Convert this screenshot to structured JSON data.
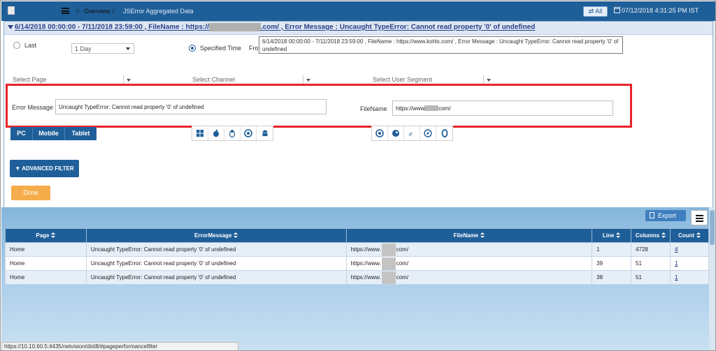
{
  "header": {
    "breadcrumb_overview": "Overview",
    "breadcrumb_sep": "/",
    "breadcrumb_current": "JSError Aggregated Data",
    "all_button": "All",
    "datetime": "07/12/2018 4:31:25 PM IST"
  },
  "filter": {
    "title_prefix": "6/14/2018 00:00:00 - 7/11/2018 23:59:00 , FileName : https://",
    "title_suffix": ".com/ , Error Message : Uncaught TypeError: Cannot read property '0' of undefined",
    "tooltip": "6/14/2018 00:00:00 - 7/11/2018 23:59:00 ,  FileName : https://www.kohls.com/ ,  Error Message : Uncaught TypeError: Cannot read property '0' of undefined",
    "last_label": "Last",
    "last_value": "1 Day",
    "specified_label": "Specified Time",
    "from_label": "Fron",
    "select_page": "Select Page",
    "select_channel": "Select Channel",
    "select_user_segment": "Select User Segment",
    "error_message_label": "Error Message",
    "error_message_value": "Uncaught TypeError: Cannot read property '0' of undefined",
    "filename_label": "FileName",
    "filename_prefix": "https://www",
    "filename_suffix": "com/",
    "devices": [
      "PC",
      "Mobile",
      "Tablet"
    ],
    "os_icons": [
      "windows-icon",
      "apple-icon",
      "linux-icon",
      "chrome-os-icon",
      "android-icon"
    ],
    "browser_icons": [
      "chrome-icon",
      "firefox-icon",
      "ie-icon",
      "safari-icon",
      "opera-icon"
    ],
    "advanced_filter": "ADVANCED FILTER",
    "done": "Done"
  },
  "table": {
    "export": "Export",
    "columns": [
      "Page",
      "ErrorMessage",
      "FileName",
      "Line",
      "Columns",
      "Count"
    ],
    "rows": [
      {
        "page": "Home",
        "error": "Uncaught TypeError: Cannot read property '0' of undefined",
        "file_prefix": "https://www.",
        "file_suffix": "com/",
        "line": "1",
        "columns": "4728",
        "count": "4"
      },
      {
        "page": "Home",
        "error": "Uncaught TypeError: Cannot read property '0' of undefined",
        "file_prefix": "https://www.",
        "file_suffix": "com/",
        "line": "39",
        "columns": "51",
        "count": "1"
      },
      {
        "page": "Home",
        "error": "Uncaught TypeError: Cannot read property '0' of undefined",
        "file_prefix": "https://www.",
        "file_suffix": "com/",
        "line": "38",
        "columns": "51",
        "count": "1"
      }
    ]
  },
  "status_url": "https://10.10.60.5:4435/netvision/dist8/#pageperformancefilter",
  "colors": {
    "brand": "#1f5f99",
    "highlight": "#e8232b",
    "done": "#f5ad4b"
  }
}
